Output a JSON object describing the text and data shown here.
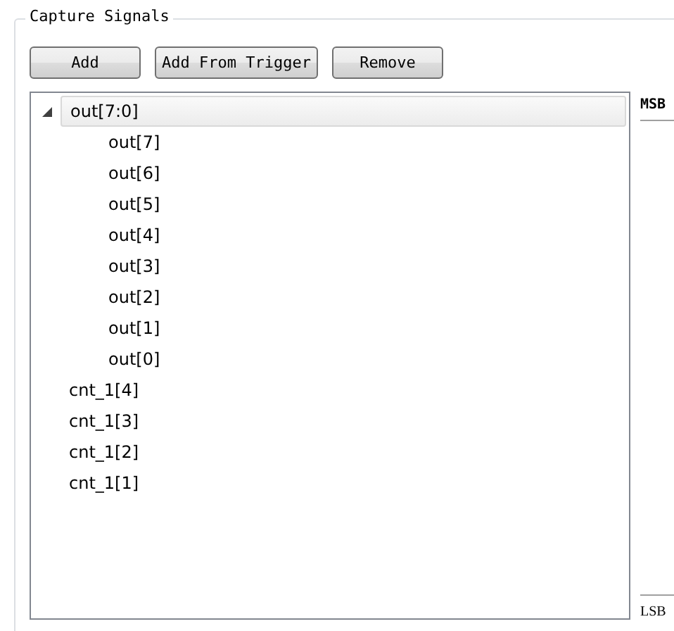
{
  "group": {
    "title": "Capture Signals"
  },
  "buttons": [
    "Add",
    "Add From Trigger",
    "Remove"
  ],
  "signals": [
    {
      "label": "out[7:0]",
      "selected": true,
      "expanded": true,
      "children": [
        {
          "label": "out[7]",
          "selected": false
        },
        {
          "label": "out[6]",
          "selected": false
        },
        {
          "label": "out[5]",
          "selected": false
        },
        {
          "label": "out[4]",
          "selected": false
        },
        {
          "label": "out[3]",
          "selected": false
        },
        {
          "label": "out[2]",
          "selected": false
        },
        {
          "label": "out[1]",
          "selected": false
        },
        {
          "label": "out[0]",
          "selected": false
        }
      ]
    },
    {
      "label": "cnt_1[4]",
      "selected": false
    },
    {
      "label": "cnt_1[3]",
      "selected": false
    },
    {
      "label": "cnt_1[2]",
      "selected": false
    },
    {
      "label": "cnt_1[1]",
      "selected": false
    }
  ],
  "order": {
    "top": "MSB",
    "bottom": "LSB"
  }
}
